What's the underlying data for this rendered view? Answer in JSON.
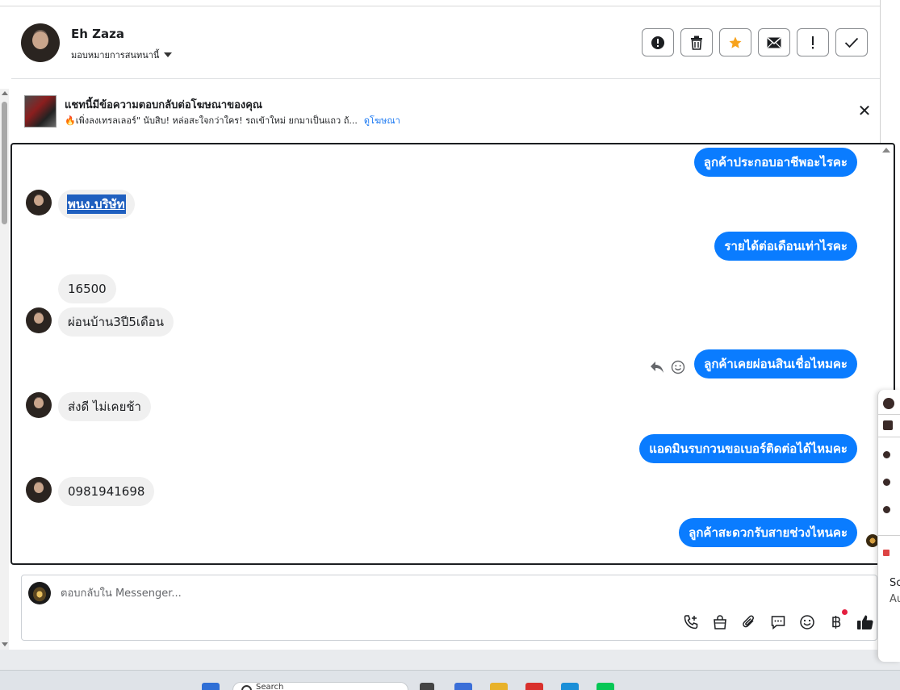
{
  "header": {
    "contact_name": "Eh Zaza",
    "assign_label": "มอบหมายการสนทนานี้"
  },
  "actions": [
    {
      "name": "report-button",
      "icon": "alert-circle-icon"
    },
    {
      "name": "delete-button",
      "icon": "trash-icon"
    },
    {
      "name": "star-button",
      "icon": "star-icon"
    },
    {
      "name": "mark-unread-button",
      "icon": "mail-icon"
    },
    {
      "name": "spam-button",
      "icon": "exclamation-icon"
    },
    {
      "name": "mark-done-button",
      "icon": "check-icon"
    }
  ],
  "ad_banner": {
    "title": "แชทนี้มีข้อความตอบกลับต่อโฆษณาของคุณ",
    "subtitle": "🔥เพิ่งลงเทรลเลอร์\" นับสิบ! หล่อสะใจกว่าใคร! รถเข้าใหม่ ยกมาเป็นแถว ถ้...",
    "link": "ดูโฆษณา",
    "close": "✕"
  },
  "messages": [
    {
      "dir": "out",
      "text": "ลูกค้าประกอบอาชีพอะไรคะ"
    },
    {
      "dir": "in",
      "text": "พนง.บริษัท"
    },
    {
      "dir": "out",
      "text": "รายได้ต่อเดือนเท่าไรคะ"
    },
    {
      "dir": "in",
      "text": "16500"
    },
    {
      "dir": "in",
      "text": "ผ่อนบ้าน3ปี5เดือน"
    },
    {
      "dir": "out",
      "text": "ลูกค้าเคยผ่อนสินเชื่อไหมคะ"
    },
    {
      "dir": "in",
      "text": "ส่งดี ไม่เคยช้า"
    },
    {
      "dir": "out",
      "text": "แอดมินรบกวนขอเบอร์ติดต่อได้ไหมคะ"
    },
    {
      "dir": "in",
      "text": "0981941698"
    },
    {
      "dir": "out",
      "text": "ลูกค้าสะดวกรับสายช่วงไหนคะ"
    }
  ],
  "composer": {
    "placeholder": "ตอบกลับใน Messenger..."
  },
  "composer_tools": [
    {
      "name": "call-icon"
    },
    {
      "name": "shopping-bag-icon"
    },
    {
      "name": "attach-icon"
    },
    {
      "name": "saved-replies-icon"
    },
    {
      "name": "emoji-icon"
    },
    {
      "name": "payment-baht-icon"
    },
    {
      "name": "thumbs-up-icon"
    }
  ],
  "taskbar": {
    "search_text": "Search"
  },
  "float_panel": {
    "line1": "Sc",
    "line2": "Au"
  },
  "colors": {
    "outgoing_bubble": "#0a7cff",
    "incoming_bubble": "#f0f0f0",
    "link": "#1877f2",
    "star": "#f7a21b"
  }
}
